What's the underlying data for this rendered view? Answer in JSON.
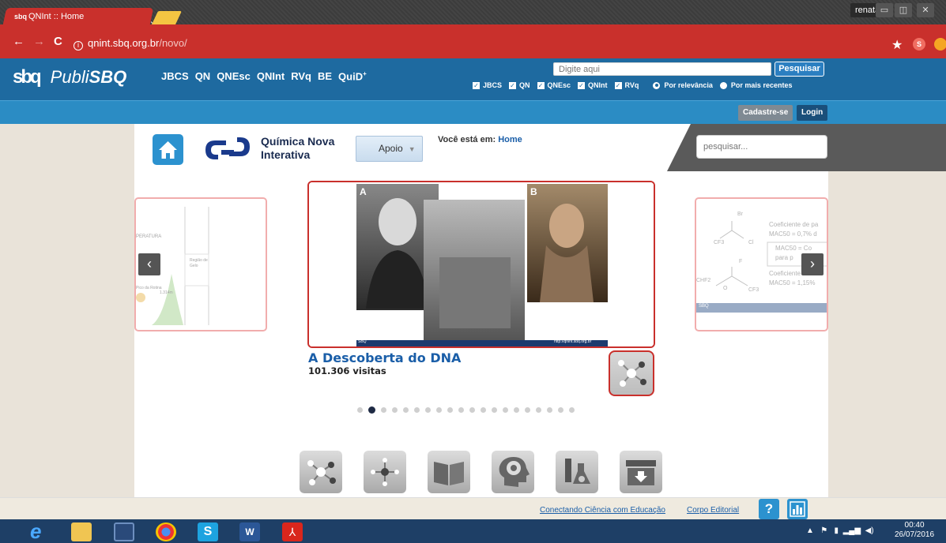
{
  "browser": {
    "tab_title": "QNInt :: Home",
    "tab_favicon": "sbq",
    "tab_close": "×",
    "user": "renata",
    "url_host": "qnint.sbq.org.br",
    "url_path": "/novo/",
    "back": "←",
    "forward": "→",
    "reload": "C",
    "minimize": "▭",
    "maximize": "◫",
    "close": "✕"
  },
  "publisbq": {
    "logo_mark": "sbq",
    "logo_prefix": "Publi",
    "logo_suffix": "SBQ",
    "links": [
      "JBCS",
      "QN",
      "QNEsc",
      "QNInt",
      "RVq",
      "BE",
      "QuiD"
    ],
    "quid_sup": "+",
    "search_placeholder": "Digite aqui",
    "search_button": "Pesquisar",
    "filters": [
      "JBCS",
      "QN",
      "QNEsc",
      "QNInt",
      "RVq"
    ],
    "sort_relevance": "Por relevância",
    "sort_recent": "Por mais recentes",
    "register": "Cadastre-se",
    "login": "Login"
  },
  "site": {
    "title_line1": "Química Nova",
    "title_line2": "Interativa",
    "apoio": "Apoio",
    "breadcrumb_label": "Você está em: ",
    "breadcrumb_current": "Home",
    "search_placeholder": "pesquisar..."
  },
  "carousel": {
    "prev": "‹",
    "next": "›",
    "main_title": "A Descoberta do DNA",
    "main_visits": "101.306 visitas",
    "label_a": "A",
    "label_b": "B",
    "caption_left": "SBQ",
    "caption_right": "http://qnint.sbq.org.br",
    "dots_count": 20,
    "active_dot": 2,
    "left_card_texts": [
      "PERATURA",
      "Pico da Rotina",
      "1.314m",
      "Região de",
      "Gelo"
    ],
    "right_card_texts": [
      "Br",
      "CF3",
      "Cl",
      "F",
      "CHF2",
      "O",
      "CF3",
      "Coeficiente de pa",
      "MAC50 = 0,7% d",
      "MAC50 = Co",
      "para p",
      "Coeficiente de",
      "MAC50 = 1,15%",
      "SBQ"
    ]
  },
  "footer": {
    "link1": "Conectando Ciência com Educação",
    "link2": "Corpo Editorial",
    "help": "?"
  },
  "taskbar": {
    "time": "00:40",
    "date": "26/07/2016"
  },
  "colors": {
    "chrome_red": "#c9302c",
    "publi_blue": "#1e6aa0",
    "bar_blue": "#2b8cc4",
    "link_blue": "#1a5ea8"
  }
}
